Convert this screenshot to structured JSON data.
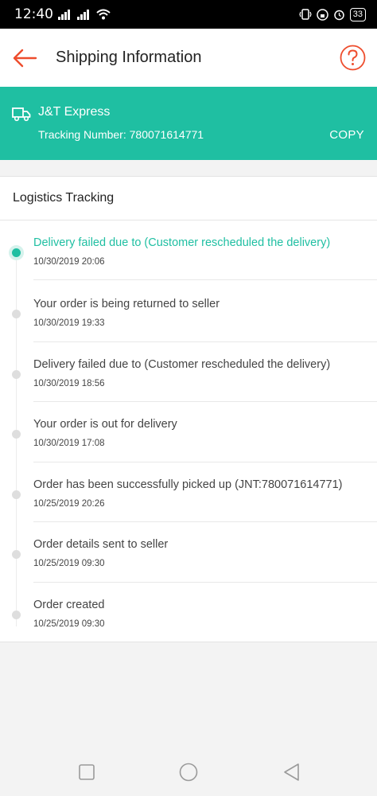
{
  "status_bar": {
    "time": "12:40",
    "battery": "33"
  },
  "header": {
    "title": "Shipping Information"
  },
  "courier": {
    "name": "J&T Express",
    "tracking_text": "Tracking Number: 780071614771",
    "copy_label": "COPY"
  },
  "logistics": {
    "title": "Logistics Tracking",
    "events": [
      {
        "description": "Delivery failed due to (Customer rescheduled the delivery)",
        "time": "10/30/2019 20:06",
        "active": true
      },
      {
        "description": "Your order is being returned to seller",
        "time": "10/30/2019 19:33",
        "active": false
      },
      {
        "description": "Delivery failed due to (Customer rescheduled the delivery)",
        "time": "10/30/2019 18:56",
        "active": false
      },
      {
        "description": "Your order is out for delivery",
        "time": "10/30/2019 17:08",
        "active": false
      },
      {
        "description": "Order has been successfully picked up (JNT:780071614771)",
        "time": "10/25/2019 20:26",
        "active": false
      },
      {
        "description": "Order details sent to seller",
        "time": "10/25/2019 09:30",
        "active": false
      },
      {
        "description": "Order created",
        "time": "10/25/2019 09:30",
        "active": false
      }
    ]
  },
  "colors": {
    "accent": "#1fbfa2",
    "brand": "#ee4d2d"
  },
  "icons": {
    "back": "arrow-left-icon",
    "help": "question-circle-icon",
    "courier": "truck-icon",
    "nav_recent": "square-icon",
    "nav_home": "circle-icon",
    "nav_back": "triangle-back-icon"
  }
}
